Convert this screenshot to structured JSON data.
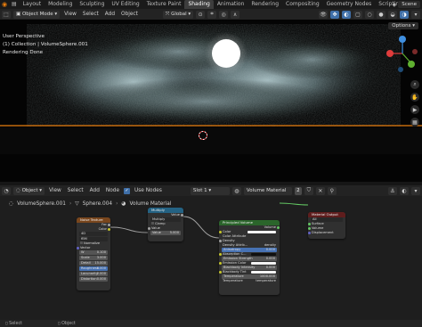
{
  "topbar": {
    "tabs": [
      "Layout",
      "Modeling",
      "Sculpting",
      "UV Editing",
      "Texture Paint",
      "Shading",
      "Animation",
      "Rendering",
      "Compositing",
      "Geometry Nodes",
      "Scripting"
    ],
    "active_tab": "Shading",
    "scene": "Scene"
  },
  "viewport_header": {
    "mode": "Object Mode",
    "menus": [
      "View",
      "Select",
      "Add",
      "Object"
    ],
    "transform": "Global",
    "options": "Options"
  },
  "viewport": {
    "info_lines": [
      "User Perspective",
      "(1) Collection | VolumeSphere.001",
      "Rendering Done"
    ]
  },
  "node_header": {
    "editor_type": "Object",
    "menus": [
      "View",
      "Select",
      "Add",
      "Node"
    ],
    "use_nodes": "Use Nodes",
    "slot": "Slot 1",
    "material": "Volume Material",
    "users": "2"
  },
  "breadcrumb": [
    "VolumeSphere.001",
    "Sphere.004",
    "Volume Material"
  ],
  "nodes": {
    "noise": {
      "title": "Noise Texture",
      "outputs": [
        "Fac",
        "Color"
      ],
      "dims": "4D",
      "type": "fBM",
      "normalize": "Normalize",
      "section": "Vector",
      "fields": [
        {
          "label": "W",
          "value": "0.100"
        },
        {
          "label": "Scale",
          "value": "3.000"
        },
        {
          "label": "Detail",
          "value": "15.000"
        },
        {
          "label": "Roughness",
          "value": "0.000"
        },
        {
          "label": "Lacunarity",
          "value": "2.000"
        },
        {
          "label": "Distortion",
          "value": "0.000"
        }
      ]
    },
    "multiply": {
      "title": "Multiply",
      "output": "Value",
      "op": "Multiply",
      "clamp": "Clamp",
      "input": "Value",
      "field": {
        "label": "Value",
        "value": "5.000"
      }
    },
    "volume": {
      "title": "Principled Volume",
      "output": "Volume",
      "rows": [
        "Color",
        "Color Attribute",
        "Density",
        "Density Attrib..."
      ],
      "density_attr": "density",
      "fields": [
        {
          "label": "Anisotropy",
          "value": "0.000"
        },
        {
          "label": "Absorption C...",
          "value": ""
        },
        {
          "label": "Emission Strength",
          "value": "0.000"
        },
        {
          "label": "Emission Color",
          "value": ""
        },
        {
          "label": "Blackbody Intensity",
          "value": "0.000"
        },
        {
          "label": "Blackbody Tint",
          "value": ""
        },
        {
          "label": "Temperature",
          "value": "1000.000"
        }
      ],
      "last_row": [
        "Temperature",
        "temperature"
      ]
    },
    "output": {
      "title": "Material Output",
      "target": "All",
      "inputs": [
        "Surface",
        "Volume",
        "Displacement"
      ]
    }
  },
  "statusbar": [
    "Select",
    "Object"
  ],
  "colors": {
    "accent_orange": "#e87d0d",
    "selection_blue": "#4772b3",
    "socket_yellow": "#c7c729",
    "socket_gray": "#a1a1a1",
    "socket_green": "#63c763",
    "socket_purple": "#6363c7",
    "header_texture": "#79461d",
    "header_converter": "#246283",
    "header_shader": "#2b652b",
    "header_output": "#5f1d1d"
  }
}
